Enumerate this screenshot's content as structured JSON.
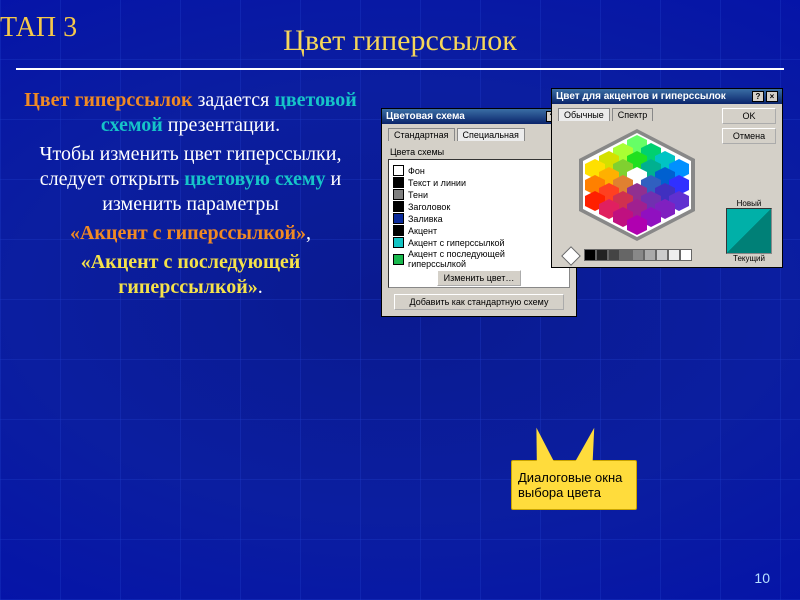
{
  "stage_label": "ТАП 3",
  "title": "Цвет гиперссылок",
  "slide_number": "10",
  "body": {
    "p1_a": "Цвет гиперссылок",
    "p1_b": " задается ",
    "p1_c": "цветовой схемой",
    "p1_d": " презентации.",
    "p2_a": "Чтобы изменить цвет гиперссылки, следует открыть ",
    "p2_b": "цветовую схему",
    "p2_c": " и изменить параметры",
    "p3": "«Акцент с гиперссылкой»",
    "p3_comma": ",",
    "p4": "«Акцент с последующей гиперссылкой»",
    "p4_dot": "."
  },
  "callout": "Диалоговые окна выбора цвета",
  "dlg1": {
    "title": "Цветовая схема",
    "tab1": "Стандартная",
    "tab2": "Специальная",
    "group": "Цвета схемы",
    "items": [
      {
        "label": "Фон",
        "color": "#ffffff"
      },
      {
        "label": "Текст и линии",
        "color": "#000000"
      },
      {
        "label": "Тени",
        "color": "#808080"
      },
      {
        "label": "Заголовок",
        "color": "#000000"
      },
      {
        "label": "Заливка",
        "color": "#0a2a9a"
      },
      {
        "label": "Акцент",
        "color": "#000000"
      },
      {
        "label": "Акцент с гиперссылкой",
        "color": "#12c4c4"
      },
      {
        "label": "Акцент с последующей гиперссылкой",
        "color": "#19b84d"
      }
    ],
    "btn_change": "Изменить цвет…",
    "btn_add": "Добавить как стандартную схему"
  },
  "dlg2": {
    "title": "Цвет для акцентов и гиперссылок",
    "tab1": "Обычные",
    "tab2": "Спектр",
    "ok": "OK",
    "cancel": "Отмена",
    "new": "Новый",
    "current": "Текущий"
  }
}
